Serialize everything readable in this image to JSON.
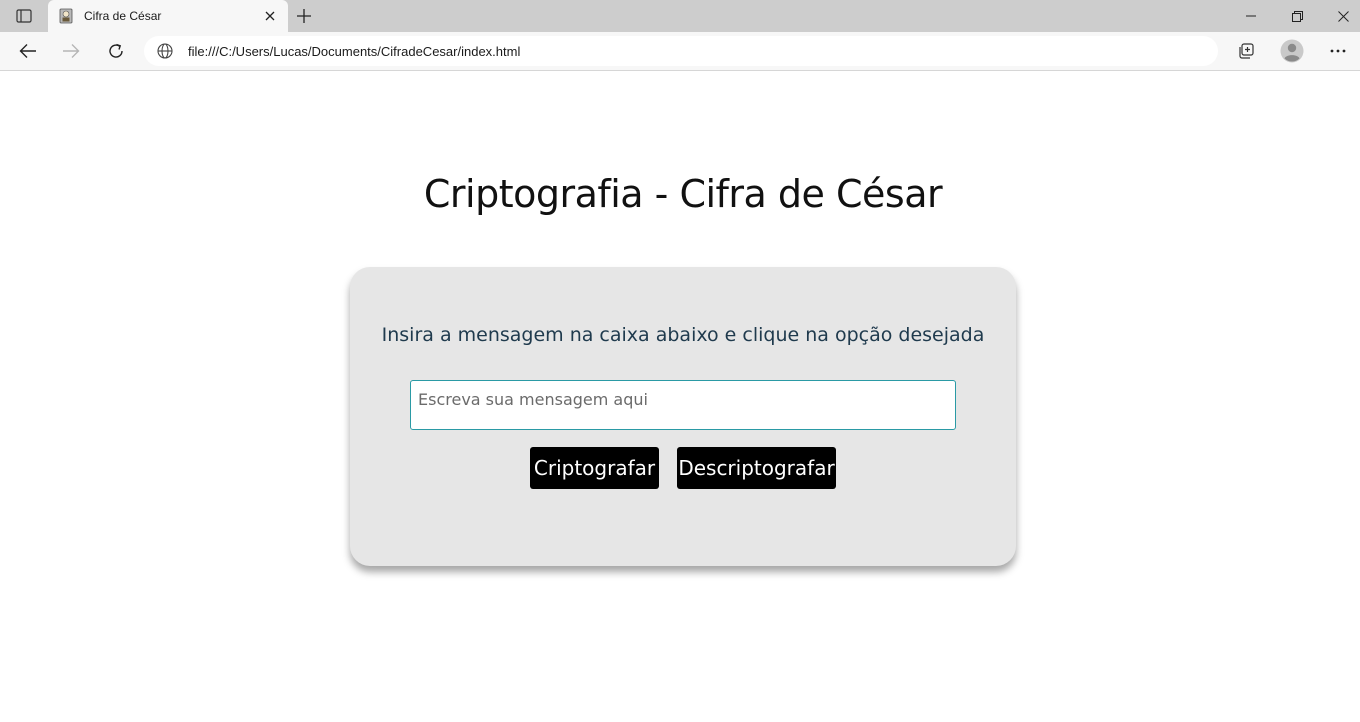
{
  "browser": {
    "tab_title": "Cifra de César",
    "address": "file:///C:/Users/Lucas/Documents/CifradeCesar/index.html",
    "icons": {
      "tab_actions": "tab-actions-icon",
      "favicon": "page-favicon-icon",
      "tab_close": "close-icon",
      "new_tab": "plus-icon",
      "minimize": "minimize-icon",
      "maximize": "restore-icon",
      "window_close": "close-icon",
      "back": "arrow-left-icon",
      "forward": "arrow-right-icon",
      "reload": "reload-icon",
      "site_info": "globe-icon",
      "collections": "collections-icon",
      "profile": "avatar-icon",
      "more": "more-icon"
    }
  },
  "page": {
    "title": "Criptografia - Cifra de César",
    "instruction": "Insira a mensagem na caixa abaixo e clique na opção desejada",
    "input": {
      "placeholder": "Escreva sua mensagem aqui",
      "value": ""
    },
    "buttons": {
      "encrypt": "Criptografar",
      "decrypt": "Descriptografar"
    },
    "colors": {
      "card_bg": "#e6e6e6",
      "button_bg": "#000000",
      "button_text": "#ffffff",
      "input_border": "#2a9aa5",
      "instruction_text": "#1f3a4d"
    }
  }
}
